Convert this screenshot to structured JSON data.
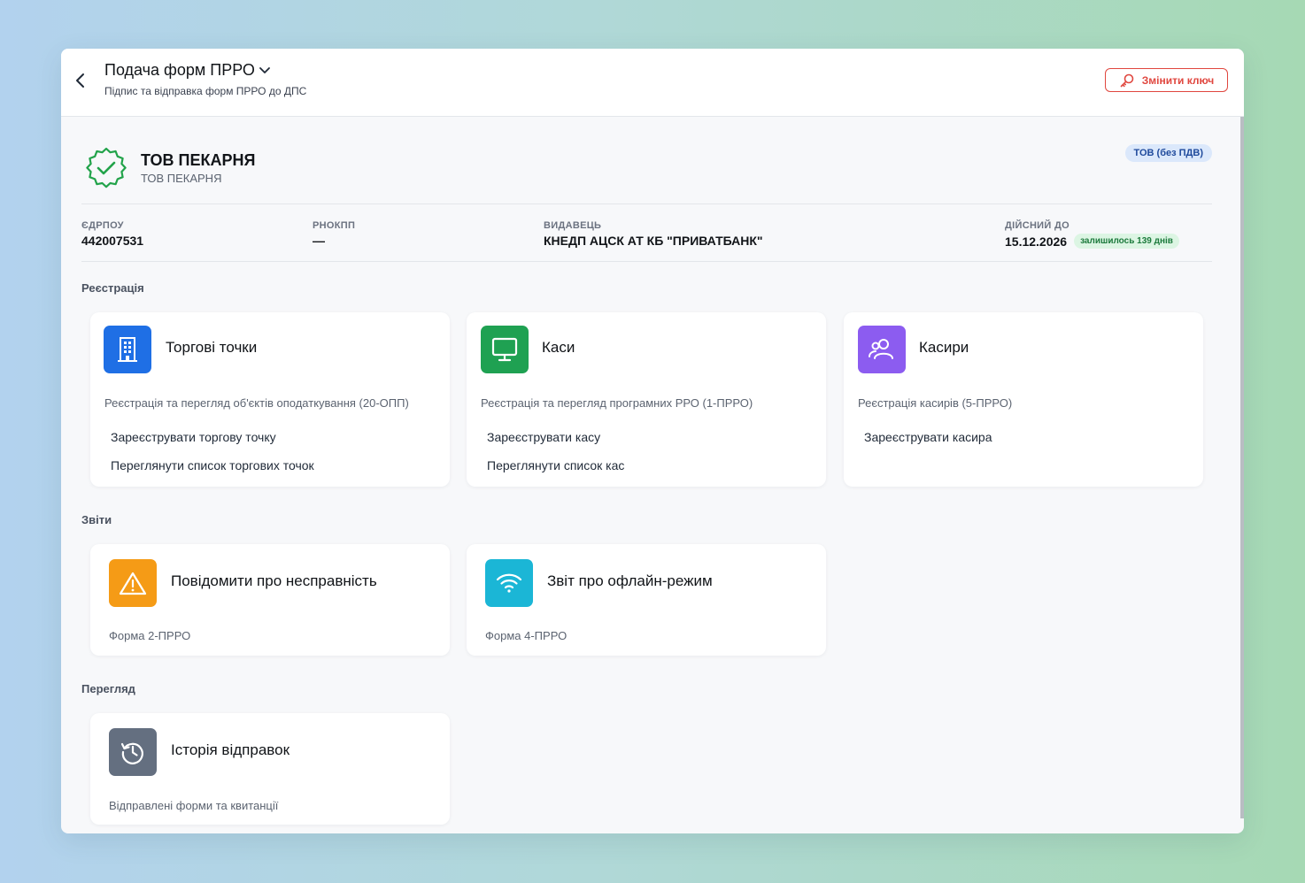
{
  "header": {
    "title": "Подача форм ПРРО",
    "subtitle": "Підпис та відправка форм ПРРО до ДПС",
    "change_key_label": "Змінити ключ"
  },
  "company": {
    "name": "ТОВ ПЕКАРНЯ",
    "subname": "ТОВ ПЕКАРНЯ",
    "type_badge": "ТОВ (без ПДВ)"
  },
  "info": {
    "edrpou_label": "ЄДРПОУ",
    "edrpou_value": "442007531",
    "rnokpp_label": "РНОКПП",
    "rnokpp_value": "—",
    "issuer_label": "ВИДАВЕЦЬ",
    "issuer_value": "КНЕДП АЦСК АТ КБ \"ПРИВАТБАНК\"",
    "valid_label": "ДІЙСНИЙ ДО",
    "valid_value": "15.12.2026",
    "remaining": "залишилось 139 днів"
  },
  "sections": {
    "registration": "Реєстрація",
    "reports": "Звіти",
    "view": "Перегляд"
  },
  "cards": {
    "outlets": {
      "title": "Торгові точки",
      "desc": "Реєстрація та перегляд об'єктів оподаткування (20-ОПП)",
      "link1": "Зареєструвати торгову точку",
      "link2": "Переглянути список торгових точок"
    },
    "cash": {
      "title": "Каси",
      "desc": "Реєстрація та перегляд програмних РРО (1-ПРРО)",
      "link1": "Зареєструвати касу",
      "link2": "Переглянути список кас"
    },
    "cashiers": {
      "title": "Касири",
      "desc": "Реєстрація касирів (5-ПРРО)",
      "link1": "Зареєструвати касира"
    },
    "malfunction": {
      "title": "Повідомити про несправність",
      "desc": "Форма 2-ПРРО"
    },
    "offline": {
      "title": "Звіт про офлайн-режим",
      "desc": "Форма 4-ПРРО"
    },
    "history": {
      "title": "Історія відправок",
      "desc": "Відправлені форми та квитанції"
    }
  },
  "colors": {
    "outlets_icon": "#1f6fe5",
    "cash_icon": "#1fa152",
    "cashiers_icon": "#8c5cf0",
    "malfunction_icon": "#f59b16",
    "offline_icon": "#1bb6d6",
    "history_icon": "#646f80",
    "accent_red": "#e0473f",
    "verified_green": "#22a34a"
  },
  "icons": {
    "back": "chevron-left-icon",
    "title_dropdown": "chevron-down-icon",
    "change_key": "key-icon",
    "verified": "verified-badge-icon",
    "outlets": "building-icon",
    "cash": "monitor-icon",
    "cashiers": "users-icon",
    "malfunction": "warning-icon",
    "offline": "wifi-icon",
    "history": "history-icon"
  }
}
